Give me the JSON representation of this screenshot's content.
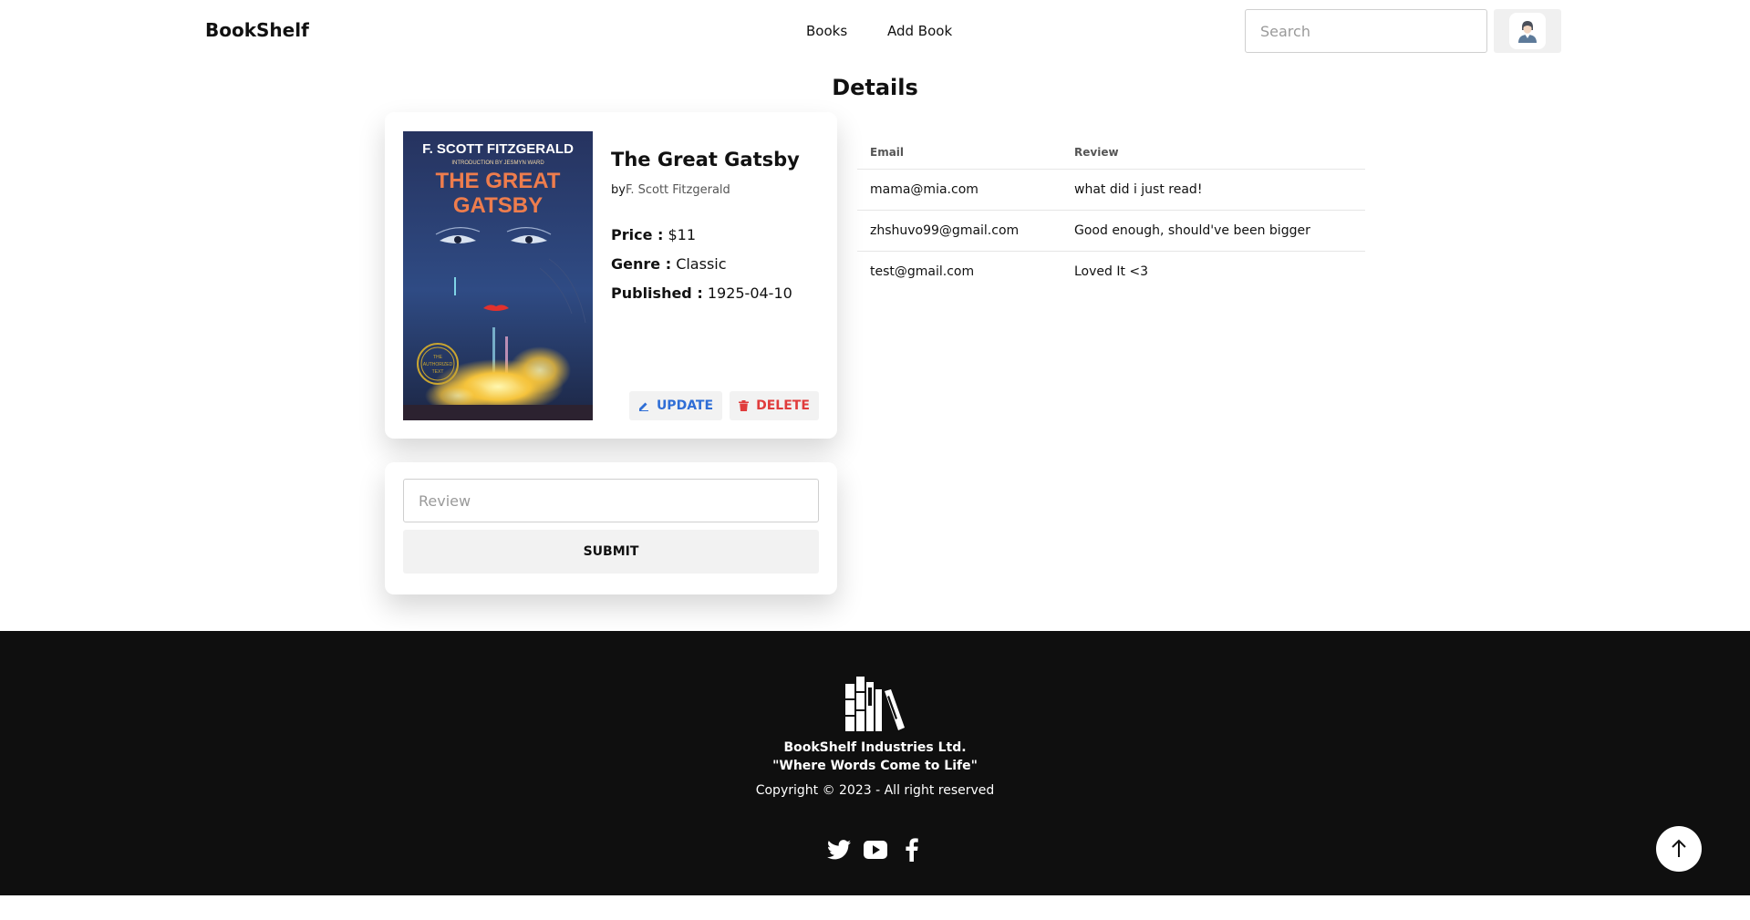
{
  "header": {
    "brand": "BookShelf",
    "nav": [
      {
        "label": "Books"
      },
      {
        "label": "Add Book"
      }
    ],
    "search_placeholder": "Search"
  },
  "page_title": "Details",
  "book": {
    "title": "The Great Gatsby",
    "by_prefix": "by",
    "author": "F. Scott Fitzgerald",
    "price_label": "Price :",
    "price": "$11",
    "genre_label": "Genre :",
    "genre": "Classic",
    "published_label": "Published :",
    "published": "1925-04-10",
    "cover": {
      "author_line": "F. SCOTT FITZGERALD",
      "intro_line": "INTRODUCTION BY JESMYN WARD",
      "title_line1": "THE GREAT",
      "title_line2": "GATSBY",
      "seal_line1": "THE",
      "seal_line2": "AUTHORIZED",
      "seal_line3": "TEXT"
    },
    "update_label": "UPDATE",
    "delete_label": "DELETE"
  },
  "review_form": {
    "placeholder": "Review",
    "value": "",
    "submit_label": "SUBMIT"
  },
  "reviews": {
    "columns": [
      "Email",
      "Review"
    ],
    "rows": [
      [
        "mama@mia.com",
        "what did i just read!"
      ],
      [
        "zhshuvo99@gmail.com",
        "Good enough, should've been bigger"
      ],
      [
        "test@gmail.com",
        "Loved It <3"
      ]
    ]
  },
  "footer": {
    "company": "BookShelf Industries Ltd.",
    "tagline": "\"Where Words Come to Life\"",
    "copyright": "Copyright © 2023 - All right reserved",
    "social_icons": [
      "twitter-icon",
      "youtube-icon",
      "facebook-icon"
    ]
  },
  "colors": {
    "update": "#2f6ed6",
    "delete": "#e03c3c",
    "footer_bg": "#0f0f0f"
  }
}
